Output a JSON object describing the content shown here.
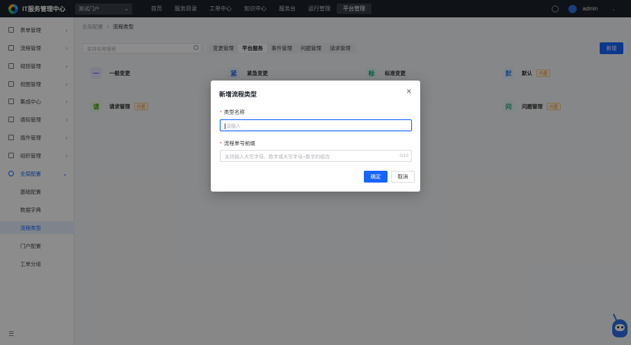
{
  "header": {
    "app_title": "IT服务管理中心",
    "portal_select": "测试门户",
    "nav": [
      "首页",
      "服务目录",
      "工单中心",
      "知识中心",
      "服务台",
      "运行管理",
      "平台管理"
    ],
    "username": "admin"
  },
  "sidebar": {
    "items": [
      {
        "label": "表单管理"
      },
      {
        "label": "流程管理"
      },
      {
        "label": "规则管理"
      },
      {
        "label": "视图管理"
      },
      {
        "label": "集成中心"
      },
      {
        "label": "通知管理"
      },
      {
        "label": "插件管理"
      },
      {
        "label": "组织管理"
      },
      {
        "label": "全局配置"
      }
    ],
    "subitems": [
      "基础配置",
      "数据字典",
      "流程类型",
      "门户配置",
      "工单分组"
    ]
  },
  "breadcrumb": {
    "parent": "全局配置",
    "separator": "/",
    "current": "流程类型"
  },
  "search": {
    "placeholder": "支持名称搜索"
  },
  "tabs": [
    "变更管理",
    "平台服务",
    "事件管理",
    "问题管理",
    "请求管理"
  ],
  "new_button": "新增",
  "cards": [
    {
      "tag": "一",
      "name": "一般变更",
      "badge": ""
    },
    {
      "tag": "紧",
      "name": "紧急变更",
      "badge": ""
    },
    {
      "tag": "标",
      "name": "标准变更",
      "badge": ""
    },
    {
      "tag": "默",
      "name": "默认",
      "badge": "内置"
    },
    {
      "tag": "请",
      "name": "请求管理",
      "badge": "内置"
    },
    {
      "tag": "问",
      "name": "问题管理",
      "badge": "内置"
    }
  ],
  "modal": {
    "title": "新增流程类型",
    "close_icon": "close-icon",
    "field1_label": "类型名称",
    "field1_placeholder": "请输入",
    "field2_label": "流程单号前缀",
    "field2_placeholder": "支持输入大写字母、数字或大写字母+数字的组合",
    "field2_count": "0/10",
    "ok": "确定",
    "cancel": "取消"
  },
  "colors": {
    "accent": "#1664ff",
    "topbar": "#1d2129",
    "required": "#f53f3f"
  }
}
